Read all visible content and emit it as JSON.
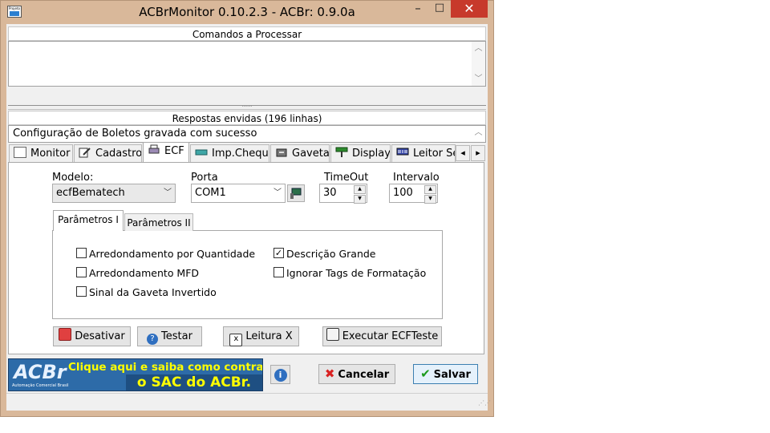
{
  "window": {
    "title": "ACBrMonitor 0.10.2.3 - ACBr: 0.9.0a",
    "app_icon_text": "Projeto",
    "minimize": "–",
    "maximize": "□",
    "close": "✕"
  },
  "commands": {
    "title": "Comandos a Processar",
    "text": ""
  },
  "responses": {
    "title": "Respostas envidas (196 linhas)",
    "first_line": "Configuração de Boletos gravada com sucesso"
  },
  "tabs": [
    {
      "label": "Monitor",
      "icon": "projeto-icon"
    },
    {
      "label": "Cadastro",
      "icon": "edit-icon"
    },
    {
      "label": "ECF",
      "icon": "printer-icon"
    },
    {
      "label": "Imp.Cheque",
      "icon": "cheque-icon"
    },
    {
      "label": "Gaveta",
      "icon": "drawer-icon"
    },
    {
      "label": "Display",
      "icon": "display-icon"
    },
    {
      "label": "Leitor Se",
      "icon": "barcode-icon"
    }
  ],
  "tab_scroll": {
    "left": "◂",
    "right": "▸"
  },
  "ecf": {
    "modelo_label": "Modelo:",
    "modelo_value": "ecfBematech",
    "porta_label": "Porta",
    "porta_value": "COM1",
    "timeout_label": "TimeOut",
    "timeout_value": "30",
    "intervalo_label": "Intervalo",
    "intervalo_value": "100"
  },
  "subtabs": [
    {
      "label": "Parâmetros I"
    },
    {
      "label": "Parâmetros II"
    }
  ],
  "params": {
    "arredondamento_quantidade": {
      "label": "Arredondamento por Quantidade",
      "checked": false
    },
    "arredondamento_mfd": {
      "label": "Arredondamento MFD",
      "checked": false
    },
    "sinal_gaveta": {
      "label": "Sinal da Gaveta Invertido",
      "checked": false
    },
    "descricao_grande": {
      "label": "Descrição Grande",
      "checked": true
    },
    "ignorar_tags": {
      "label": "Ignorar Tags de Formatação",
      "checked": false
    }
  },
  "buttons": {
    "desativar": "Desativar",
    "testar": "Testar",
    "leitura_x": "Leitura X",
    "executar": "Executar ECFTeste",
    "cancelar": "Cancelar",
    "salvar": "Salvar"
  },
  "banner": {
    "logo": "ACBr",
    "tagline": "Automação Comercial Brasil",
    "line1": "Clique aqui e saiba como contratar",
    "line2": "o SAC do ACBr."
  },
  "colors": {
    "frame": "#d9b89a",
    "close": "#c7392b",
    "banner": "#2d6ba8",
    "banner_text": "#ffff00"
  }
}
